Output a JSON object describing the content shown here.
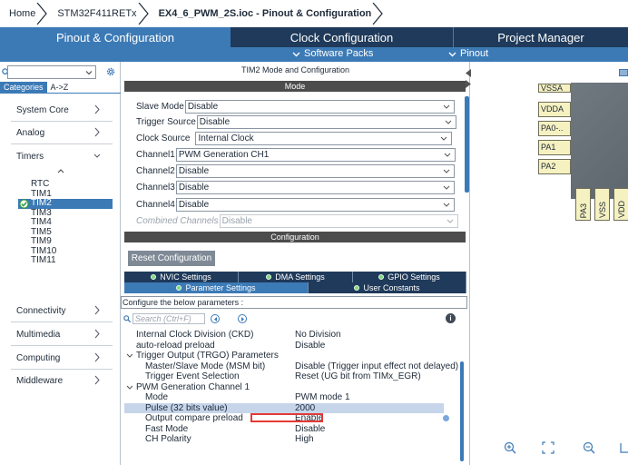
{
  "breadcrumb": [
    "Home",
    "STM32F411RETx",
    "EX4_6_PWM_2S.ioc - Pinout & Configuration"
  ],
  "top_tabs": {
    "pinout": "Pinout & Configuration",
    "clock": "Clock Configuration",
    "project": "Project Manager"
  },
  "subbar": {
    "software_packs": "Software Packs",
    "pinout": "Pinout"
  },
  "left": {
    "category_tabs": [
      "Categories",
      "A->Z"
    ],
    "categories": [
      "System Core",
      "Analog",
      "Timers",
      "Connectivity",
      "Multimedia",
      "Computing",
      "Middleware"
    ],
    "timers": [
      "RTC",
      "TIM1",
      "TIM2",
      "TIM3",
      "TIM4",
      "TIM5",
      "TIM9",
      "TIM10",
      "TIM11"
    ],
    "selected_timer": "TIM2"
  },
  "mode": {
    "title": "TIM2 Mode and Configuration",
    "band": "Mode",
    "fields": [
      {
        "label": "Slave Mode",
        "value": "Disable"
      },
      {
        "label": "Trigger Source",
        "value": "Disable"
      },
      {
        "label": "Clock Source",
        "value": "Internal Clock"
      },
      {
        "label": "Channel1",
        "value": "PWM Generation CH1"
      },
      {
        "label": "Channel2",
        "value": "Disable"
      },
      {
        "label": "Channel3",
        "value": "Disable"
      },
      {
        "label": "Channel4",
        "value": "Disable"
      },
      {
        "label": "Combined Channels",
        "value": "Disable"
      }
    ]
  },
  "config": {
    "band": "Configuration",
    "reset_button": "Reset Configuration",
    "tabs_row1": [
      "NVIC Settings",
      "DMA Settings",
      "GPIO Settings"
    ],
    "tabs_row2": [
      "Parameter Settings",
      "User Constants"
    ],
    "hint": "Configure the below parameters :",
    "search_placeholder": "Search (Ctrl+F)",
    "params": [
      {
        "name": "Internal Clock Division (CKD)",
        "value": "No Division"
      },
      {
        "name": "auto-reload preload",
        "value": "Disable"
      },
      {
        "name": "Trigger Output (TRGO) Parameters",
        "value": ""
      },
      {
        "name": "Master/Slave Mode (MSM bit)",
        "value": "Disable (Trigger input effect not delayed)"
      },
      {
        "name": "Trigger Event Selection",
        "value": "Reset (UG bit from TIMx_EGR)"
      },
      {
        "name": "PWM Generation Channel 1",
        "value": ""
      },
      {
        "name": "Mode",
        "value": "PWM mode 1"
      },
      {
        "name": "Pulse (32 bits value)",
        "value": "2000"
      },
      {
        "name": "Output compare preload",
        "value": "Enable"
      },
      {
        "name": "Fast Mode",
        "value": "Disable"
      },
      {
        "name": "CH Polarity",
        "value": "High"
      }
    ]
  },
  "pinout": {
    "pins_left": [
      "VSSA",
      "VDDA",
      "PA0-..",
      "PA1",
      "PA2"
    ],
    "pins_bottom": [
      "PA3",
      "VSS",
      "VDD"
    ]
  }
}
